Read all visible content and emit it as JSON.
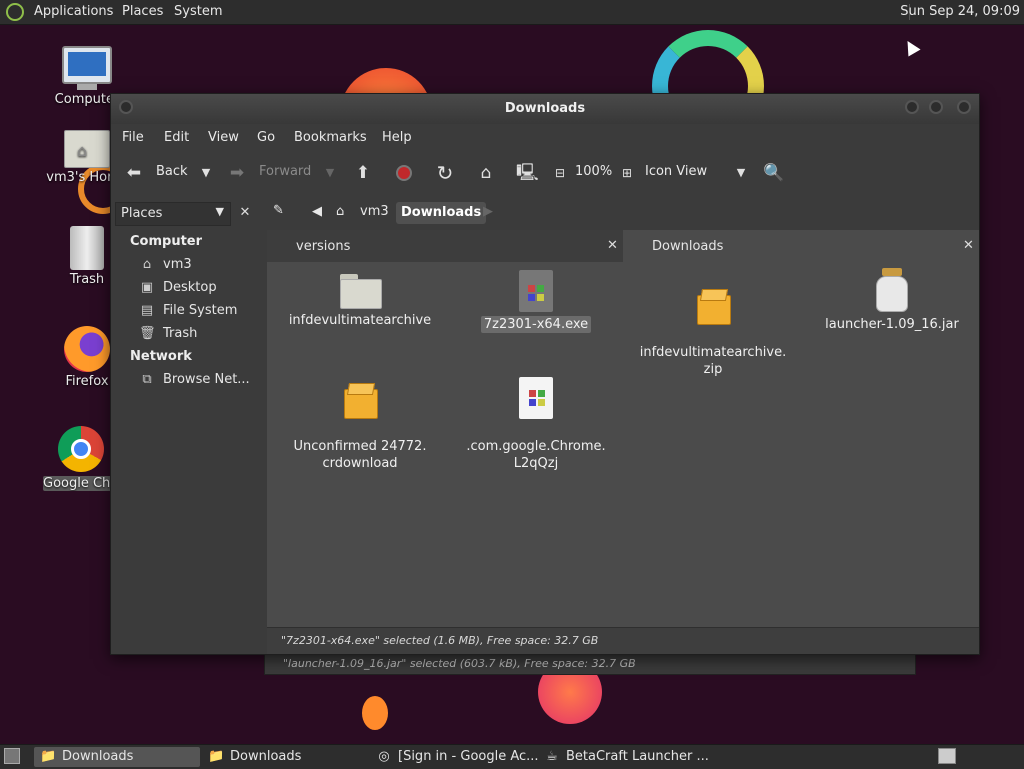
{
  "top_panel": {
    "menus": [
      "Applications",
      "Places",
      "System"
    ],
    "clock": "Sun Sep 24, 09:09",
    "logo_icon": "mate-logo-icon"
  },
  "desktop_icons": [
    {
      "label": "Computer",
      "icon": "computer-icon"
    },
    {
      "label": "vm3's Home",
      "icon": "home-folder-icon"
    },
    {
      "label": "Trash",
      "icon": "trash-icon"
    },
    {
      "label": "Firefox",
      "icon": "firefox-icon"
    },
    {
      "label": "Google Chrome",
      "icon": "chrome-icon"
    }
  ],
  "back_window": {
    "status": "\"launcher-1.09_16.jar\" selected (603.7 kB), Free space: 32.7 GB"
  },
  "window": {
    "title": "Downloads",
    "menu": [
      "File",
      "Edit",
      "View",
      "Go",
      "Bookmarks",
      "Help"
    ],
    "toolbar": {
      "back": "Back",
      "forward": "Forward",
      "zoom": "100%",
      "view_mode": "Icon View"
    },
    "location": {
      "places_label": "Places",
      "crumbs": [
        "vm3",
        "Downloads"
      ]
    },
    "sidebar": {
      "sections": [
        {
          "title": "Computer",
          "items": [
            "vm3",
            "Desktop",
            "File System",
            "Trash"
          ]
        },
        {
          "title": "Network",
          "items": [
            "Browse Net..."
          ]
        }
      ]
    },
    "tabs": [
      {
        "label": "versions",
        "active": false
      },
      {
        "label": "Downloads",
        "active": true
      }
    ],
    "files": [
      {
        "name": "infdevultimatearchive",
        "type": "folder",
        "selected": false
      },
      {
        "name": "7z2301-x64.exe",
        "type": "executable",
        "selected": true
      },
      {
        "name": "infdevultimatearchive.\nzip",
        "type": "archive",
        "selected": false
      },
      {
        "name": "launcher-1.09_16.jar",
        "type": "jar",
        "selected": false
      },
      {
        "name": "Unconfirmed 24772.\ncrdownload",
        "type": "archive",
        "selected": false
      },
      {
        "name": ".com.google.Chrome.\nL2qQzj",
        "type": "document",
        "selected": false
      }
    ],
    "status": "\"7z2301-x64.exe\" selected (1.6 MB), Free space: 32.7 GB"
  },
  "taskbar": {
    "items": [
      {
        "label": "Downloads",
        "icon": "folder-icon",
        "active": true
      },
      {
        "label": "Downloads",
        "icon": "folder-icon",
        "active": false
      },
      {
        "label": "[Sign in - Google Ac...",
        "icon": "chrome-icon",
        "active": false
      },
      {
        "label": "BetaCraft Launcher ...",
        "icon": "java-icon",
        "active": false
      }
    ]
  },
  "colors": {
    "desktop_bg": "#2a0c22",
    "window_bg": "#3b3b3b",
    "content_bg": "#4b4b4b",
    "stop_red": "#c0282b",
    "package_orange": "#f2b030"
  }
}
